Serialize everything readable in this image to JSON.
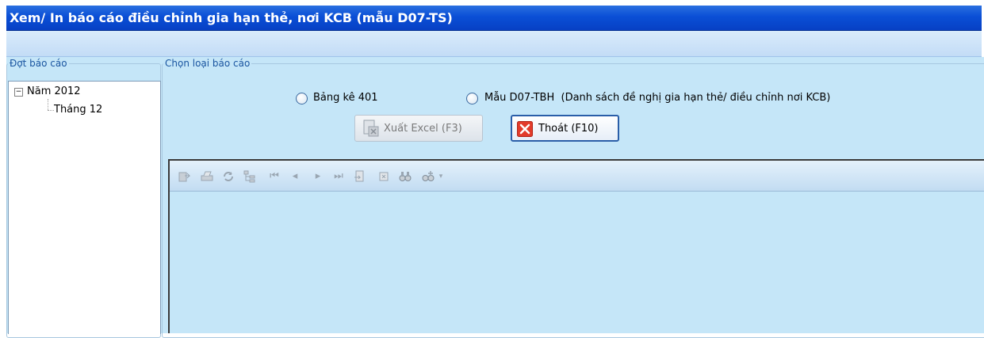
{
  "window": {
    "title": "Xem/ In báo cáo điều chỉnh gia hạn thẻ, nơi KCB (mẫu D07-TS)"
  },
  "period_panel": {
    "legend": "Đợt báo cáo",
    "tree": {
      "year": {
        "label": "Năm 2012",
        "expanded": true
      },
      "month": {
        "label": "Tháng 12"
      }
    }
  },
  "report_type_panel": {
    "legend": "Chọn loại báo cáo",
    "options": [
      {
        "label": "Bảng kê 401",
        "selected": false
      },
      {
        "label": "Mẫu D07-TBH  (Danh sách đề nghị gia hạn thẻ/ điều chỉnh nơi KCB)",
        "selected": false
      }
    ],
    "buttons": {
      "export_excel": {
        "label": "Xuất Excel (F3)",
        "enabled": false
      },
      "exit": {
        "label": "Thoát (F10)",
        "enabled": true
      }
    }
  },
  "report_viewer": {
    "toolbar_icons": [
      "export-icon",
      "print-icon",
      "refresh-icon",
      "tree-toggle-icon",
      "first-page-icon",
      "previous-page-icon",
      "next-page-icon",
      "last-page-icon",
      "goto-page-icon",
      "stop-icon",
      "find-icon",
      "zoom-icon"
    ]
  },
  "colors": {
    "title_bar": "#0a4fd6",
    "panel_background": "#c5e6f8",
    "legend_text": "#1a55a0",
    "exit_icon": "#e23b2b"
  }
}
